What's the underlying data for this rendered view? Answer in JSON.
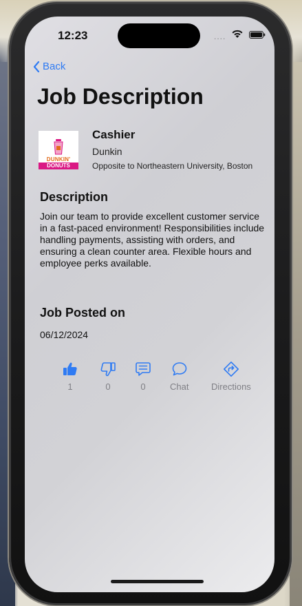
{
  "status_bar": {
    "time": "12:23",
    "signal": "....",
    "icons": [
      "wifi-icon",
      "battery-icon"
    ]
  },
  "nav": {
    "back_label": "Back"
  },
  "page": {
    "title": "Job Description"
  },
  "job": {
    "title": "Cashier",
    "company": "Dunkin",
    "location": "Opposite to Northeastern University, Boston",
    "logo": {
      "line1": "DUNKIN'",
      "line2": "DONUTS",
      "colors": {
        "orange": "#e36b1a",
        "pink": "#da1884"
      }
    }
  },
  "description": {
    "heading": "Description",
    "body": "Join our team to provide excellent customer service in a fast-paced environment! Responsibilities include handling payments, assisting with orders, and ensuring a clean counter area. Flexible hours and employee perks available."
  },
  "posted": {
    "heading": "Job Posted on",
    "date": "06/12/2024"
  },
  "actions": [
    {
      "icon": "thumbs-up-icon",
      "label": "1"
    },
    {
      "icon": "thumbs-down-icon",
      "label": "0"
    },
    {
      "icon": "comment-icon",
      "label": "0"
    },
    {
      "icon": "chat-bubble-icon",
      "label": "Chat"
    },
    {
      "icon": "directions-icon",
      "label": "Directions"
    }
  ],
  "theme": {
    "accent": "#2f7bf3",
    "muted_text": "#7e7e84"
  }
}
